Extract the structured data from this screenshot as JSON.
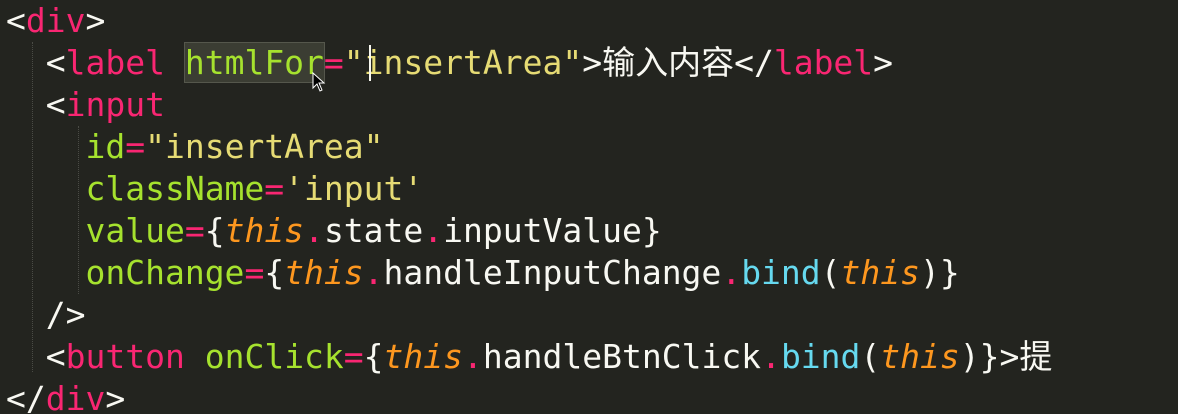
{
  "editor": {
    "lines": [
      {
        "indent": "",
        "tokens": [
          {
            "t": "<",
            "c": "punct"
          },
          {
            "t": "div",
            "c": "tag"
          },
          {
            "t": ">",
            "c": "punct"
          }
        ]
      },
      {
        "indent": "  ",
        "tokens": [
          {
            "t": "<",
            "c": "punct"
          },
          {
            "t": "label",
            "c": "tag"
          },
          {
            "t": " ",
            "c": "punct"
          },
          {
            "t": "htmlFor",
            "c": "attr",
            "hl": true
          },
          {
            "t": "=",
            "c": "eq"
          },
          {
            "t": "\"insertArea\"",
            "c": "str"
          },
          {
            "t": ">输入内容</",
            "c": "text"
          },
          {
            "t": "label",
            "c": "tag"
          },
          {
            "t": ">",
            "c": "punct"
          }
        ]
      },
      {
        "indent": "  ",
        "tokens": [
          {
            "t": "<",
            "c": "punct"
          },
          {
            "t": "input",
            "c": "tag"
          }
        ]
      },
      {
        "indent": "    ",
        "tokens": [
          {
            "t": "id",
            "c": "attr"
          },
          {
            "t": "=",
            "c": "eq"
          },
          {
            "t": "\"insertArea\"",
            "c": "str"
          }
        ]
      },
      {
        "indent": "    ",
        "tokens": [
          {
            "t": "className",
            "c": "attr"
          },
          {
            "t": "=",
            "c": "eq"
          },
          {
            "t": "'input'",
            "c": "str"
          }
        ]
      },
      {
        "indent": "    ",
        "tokens": [
          {
            "t": "value",
            "c": "attr"
          },
          {
            "t": "=",
            "c": "eq"
          },
          {
            "t": "{",
            "c": "punct"
          },
          {
            "t": "this",
            "c": "this"
          },
          {
            "t": ".",
            "c": "dot"
          },
          {
            "t": "state",
            "c": "prop"
          },
          {
            "t": ".",
            "c": "dot"
          },
          {
            "t": "inputValue",
            "c": "prop"
          },
          {
            "t": "}",
            "c": "punct"
          }
        ]
      },
      {
        "indent": "    ",
        "tokens": [
          {
            "t": "onChange",
            "c": "attr"
          },
          {
            "t": "=",
            "c": "eq"
          },
          {
            "t": "{",
            "c": "punct"
          },
          {
            "t": "this",
            "c": "this"
          },
          {
            "t": ".",
            "c": "dot"
          },
          {
            "t": "handleInputChange",
            "c": "prop"
          },
          {
            "t": ".",
            "c": "dot"
          },
          {
            "t": "bind",
            "c": "func"
          },
          {
            "t": "(",
            "c": "punct"
          },
          {
            "t": "this",
            "c": "this"
          },
          {
            "t": ")}",
            "c": "punct"
          }
        ]
      },
      {
        "indent": "  ",
        "tokens": [
          {
            "t": "/>",
            "c": "punct"
          }
        ]
      },
      {
        "indent": "  ",
        "tokens": [
          {
            "t": "<",
            "c": "punct"
          },
          {
            "t": "button",
            "c": "tag"
          },
          {
            "t": " ",
            "c": "punct"
          },
          {
            "t": "onClick",
            "c": "attr"
          },
          {
            "t": "=",
            "c": "eq"
          },
          {
            "t": "{",
            "c": "punct"
          },
          {
            "t": "this",
            "c": "this"
          },
          {
            "t": ".",
            "c": "dot"
          },
          {
            "t": "handleBtnClick",
            "c": "prop"
          },
          {
            "t": ".",
            "c": "dot"
          },
          {
            "t": "bind",
            "c": "func"
          },
          {
            "t": "(",
            "c": "punct"
          },
          {
            "t": "this",
            "c": "this"
          },
          {
            "t": ")}>提",
            "c": "punct"
          }
        ]
      },
      {
        "indent": "",
        "tokens": [
          {
            "t": "</",
            "c": "punct"
          },
          {
            "t": "div",
            "c": "tag"
          },
          {
            "t": ">",
            "c": "punct"
          }
        ]
      }
    ]
  },
  "colors": {
    "background": "#23241f",
    "tag": "#f92672",
    "attribute": "#a6e22e",
    "string": "#e6db74",
    "keyword_this": "#fd971f",
    "function": "#66d9ef",
    "text": "#f8f8f2"
  },
  "icons": {
    "mouse_pointer": "mouse-pointer-icon",
    "text_cursor": "text-cursor-icon"
  }
}
